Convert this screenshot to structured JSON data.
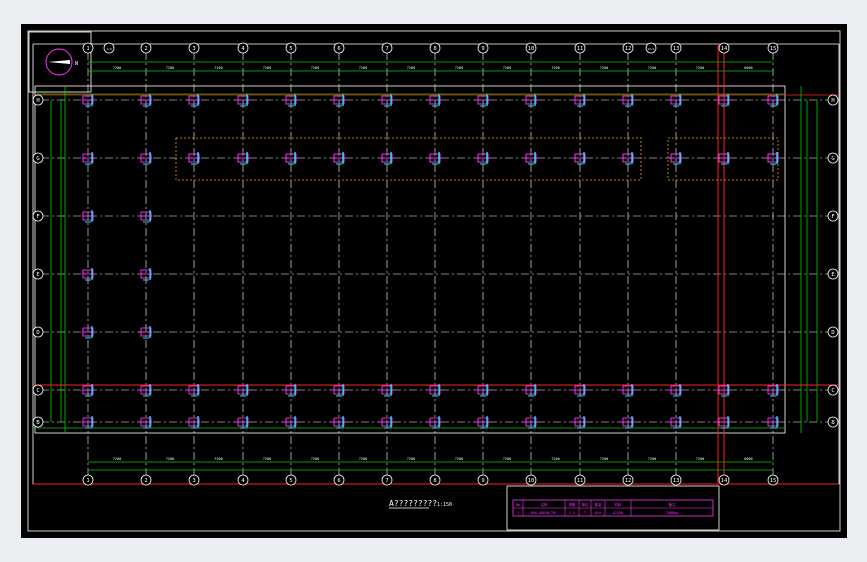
{
  "plan": {
    "title": "A?????????",
    "scale": "1:150",
    "columns": [
      "1",
      "2",
      "3",
      "4",
      "5",
      "6",
      "7",
      "8",
      "9",
      "10",
      "11",
      "12",
      "13",
      "14",
      "15"
    ],
    "rows": [
      "H",
      "G",
      "F",
      "E",
      "D",
      "C",
      "B"
    ],
    "extra_bubbles": [
      "1/2",
      "12/1"
    ],
    "dimension_label": "7200",
    "end_dimension_label": "6000"
  },
  "north_arrow": {
    "letter": "N"
  },
  "schedule": {
    "headers": [
      "No",
      "名称",
      "规格",
      "单位",
      "数量",
      "材料",
      "备注"
    ],
    "row": [
      "1",
      "RUO-AB030(TB)",
      "2.5",
      "个",
      "854",
      "Q235B",
      "7080kg"
    ]
  },
  "colors": {
    "background": "#000000",
    "border": "#ffffff",
    "grid_line": "#00cc00",
    "axis_bubble": "#ffffff",
    "red_line": "#ff2020",
    "anchor_magenta": "#ff33ff",
    "anchor_cyan": "#00ffff",
    "dashed_region": "#ff9900"
  }
}
